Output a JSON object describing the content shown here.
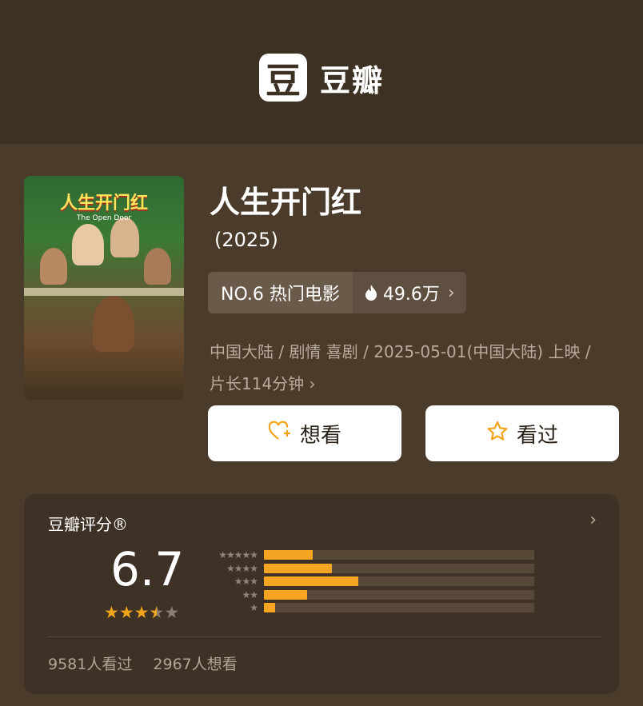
{
  "header": {
    "logo_glyph": "豆",
    "logo_text": "豆瓣"
  },
  "poster": {
    "title_text": "人生开门红",
    "subtitle_text": "The Open Door"
  },
  "movie": {
    "title": "人生开门红",
    "year": "(2025)",
    "rank_label": "NO.6 热门电影",
    "hot_icon": "fire-icon",
    "hot_count": "49.6万",
    "meta_line1": "中国大陆 / 剧情 喜剧 / 2025-05-01(中国大陆) 上映 /",
    "meta_line2": "片长114分钟"
  },
  "actions": {
    "want_label": "想看",
    "want_icon": "heart-plus-icon",
    "watched_label": "看过",
    "watched_icon": "star-outline-icon"
  },
  "rating": {
    "title": "豆瓣评分®",
    "score": "6.7",
    "stars": 3.5,
    "distribution": [
      {
        "stars": 5,
        "label": "★★★★★",
        "percent": 18
      },
      {
        "stars": 4,
        "label": "★★★★",
        "percent": 25
      },
      {
        "stars": 3,
        "label": "★★★",
        "percent": 35
      },
      {
        "stars": 2,
        "label": "★★",
        "percent": 16
      },
      {
        "stars": 1,
        "label": "★",
        "percent": 4
      }
    ],
    "watched_count": "9581人看过",
    "want_count": "2967人想看"
  },
  "colors": {
    "page_bg": "#4a3b2b",
    "header_bg": "#3d3124",
    "card_bg": "#3e3125",
    "accent": "#f4a622"
  }
}
